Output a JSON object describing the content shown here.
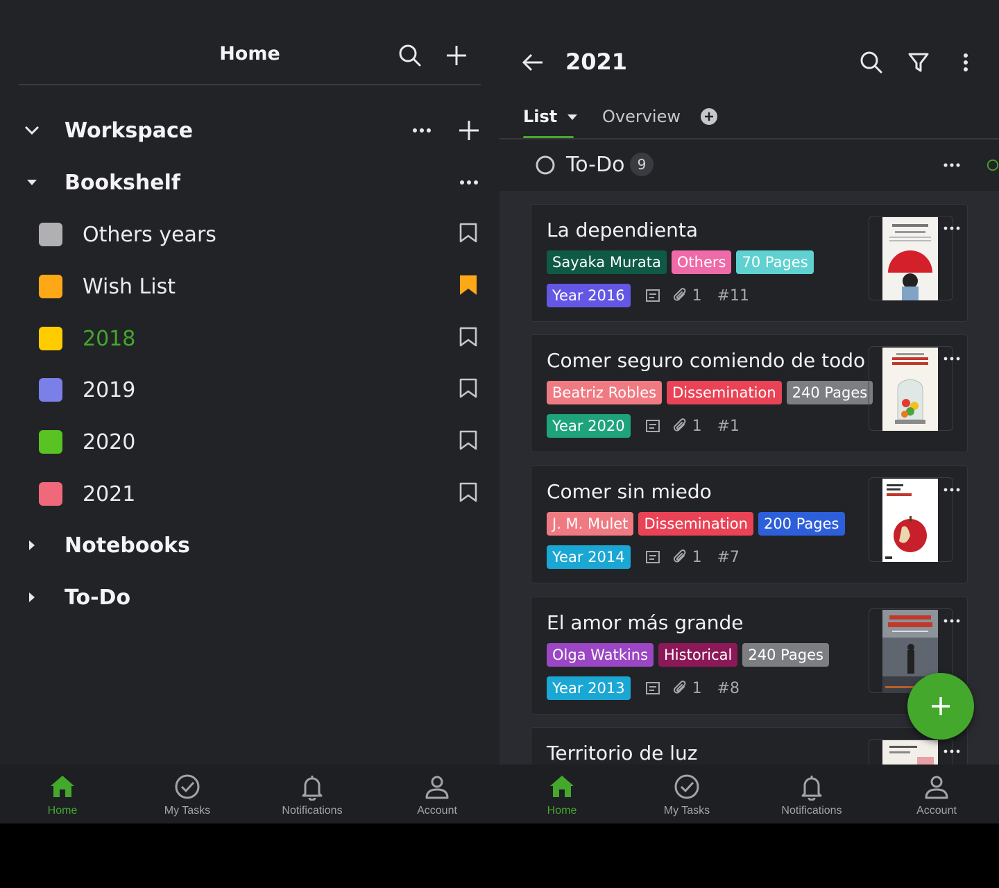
{
  "left": {
    "title": "Home",
    "workspace": {
      "label": "Workspace"
    },
    "bookshelf": {
      "label": "Bookshelf",
      "items": [
        {
          "label": "Others years",
          "color": "#b0b0b2",
          "bookmarked": false
        },
        {
          "label": "Wish List",
          "color": "#ffa816",
          "bookmarked": true
        },
        {
          "label": "2018",
          "color": "#ffcc00",
          "bookmarked": false
        },
        {
          "label": "2019",
          "color": "#7b7fe8",
          "bookmarked": false
        },
        {
          "label": "2020",
          "color": "#58c322",
          "bookmarked": false
        },
        {
          "label": "2021",
          "color": "#f0697a",
          "bookmarked": false
        }
      ]
    },
    "notebooks": {
      "label": "Notebooks"
    },
    "todo": {
      "label": "To-Do"
    }
  },
  "right": {
    "title": "2021",
    "tabs": {
      "list": "List",
      "overview": "Overview"
    },
    "group": {
      "name": "To-Do",
      "count": "9"
    },
    "cards": [
      {
        "title": "La dependienta",
        "tags": [
          {
            "text": "Sayaka Murata",
            "color": "#0f5a46"
          },
          {
            "text": "Others",
            "color": "#ef6aa8"
          },
          {
            "text": "70 Pages",
            "color": "#5fd1d1"
          }
        ],
        "year": {
          "text": "Year 2016",
          "color": "#6457e6"
        },
        "attachments": "1",
        "id": "#11"
      },
      {
        "title": "Comer seguro comiendo de todo",
        "tags": [
          {
            "text": "Beatriz Robles",
            "color": "#f07a82"
          },
          {
            "text": "Dissemination",
            "color": "#ea4356"
          },
          {
            "text": "240 Pages",
            "color": "#7d7e82"
          }
        ],
        "year": {
          "text": "Year 2020",
          "color": "#1fa37b"
        },
        "attachments": "1",
        "id": "#1"
      },
      {
        "title": "Comer sin miedo",
        "tags": [
          {
            "text": "J. M. Mulet",
            "color": "#f07a82"
          },
          {
            "text": "Dissemination",
            "color": "#ea4356"
          },
          {
            "text": "200 Pages",
            "color": "#2e5fdb"
          }
        ],
        "year": {
          "text": "Year 2014",
          "color": "#1aa7d4"
        },
        "attachments": "1",
        "id": "#7"
      },
      {
        "title": "El amor más grande",
        "tags": [
          {
            "text": "Olga Watkins",
            "color": "#9b46c4"
          },
          {
            "text": "Historical",
            "color": "#8c1858"
          },
          {
            "text": "240 Pages",
            "color": "#7d7e82"
          }
        ],
        "year": {
          "text": "Year 2013",
          "color": "#1aa7d4"
        },
        "attachments": "1",
        "id": "#8"
      },
      {
        "title": "Territorio de luz"
      }
    ]
  },
  "bottom_nav": {
    "items": [
      {
        "label": "Home",
        "icon": "home-icon",
        "active": true
      },
      {
        "label": "My Tasks",
        "icon": "check-circle-icon",
        "active": false
      },
      {
        "label": "Notifications",
        "icon": "bell-icon",
        "active": false
      },
      {
        "label": "Account",
        "icon": "person-icon",
        "active": false
      }
    ]
  },
  "colors": {
    "accent": "#43a82c",
    "background": "#222327",
    "bookmark_active": "#ffa816"
  }
}
